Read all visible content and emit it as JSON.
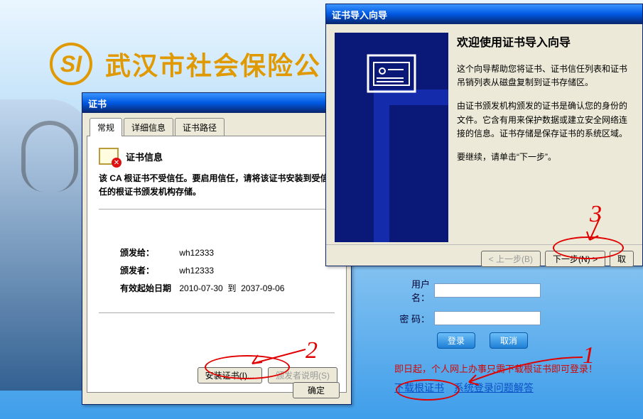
{
  "banner": {
    "logo_text": "SI",
    "title": "武汉市社会保险公"
  },
  "cert_window": {
    "title": "证书",
    "tabs": {
      "general": "常规",
      "details": "详细信息",
      "path": "证书路径"
    },
    "info_heading": "证书信息",
    "warning": "该 CA 根证书不受信任。要启用信任，请将该证书安装到受信任的根证书颁发机构存储。",
    "issued_to_label": "颁发给：",
    "issued_to": "wh12333",
    "issuer_label": "颁发者：",
    "issuer": "wh12333",
    "valid_label": "有效起始日期",
    "valid_from": "2010-07-30",
    "valid_mid": "到",
    "valid_to": "2037-09-06",
    "install_btn": "安装证书(I)...",
    "issuer_stmt_btn": "颁发者说明(S)",
    "ok_btn": "确定"
  },
  "wizard": {
    "title": "证书导入向导",
    "heading": "欢迎使用证书导入向导",
    "p1": "这个向导帮助您将证书、证书信任列表和证书吊销列表从磁盘复制到证书存储区。",
    "p2": "由证书颁发机构颁发的证书是确认您的身份的文件。它含有用来保护数据或建立安全网络连接的信息。证书存储是保存证书的系统区域。",
    "p3": "要继续，请单击“下一步”。",
    "back_btn": "< 上一步(B)",
    "next_btn": "下一步(N) >",
    "cancel_btn": "取"
  },
  "login": {
    "user_label": "用户名：",
    "pass_label": "密 码：",
    "login_btn": "登录",
    "cancel_btn": "取消",
    "notice": "即日起，个人网上办事只需下载根证书即可登录！",
    "link_download": "下载根证书",
    "link_faq": "系统登录问题解答"
  },
  "annotations": {
    "n1": "1",
    "n2": "2",
    "n3": "3"
  }
}
